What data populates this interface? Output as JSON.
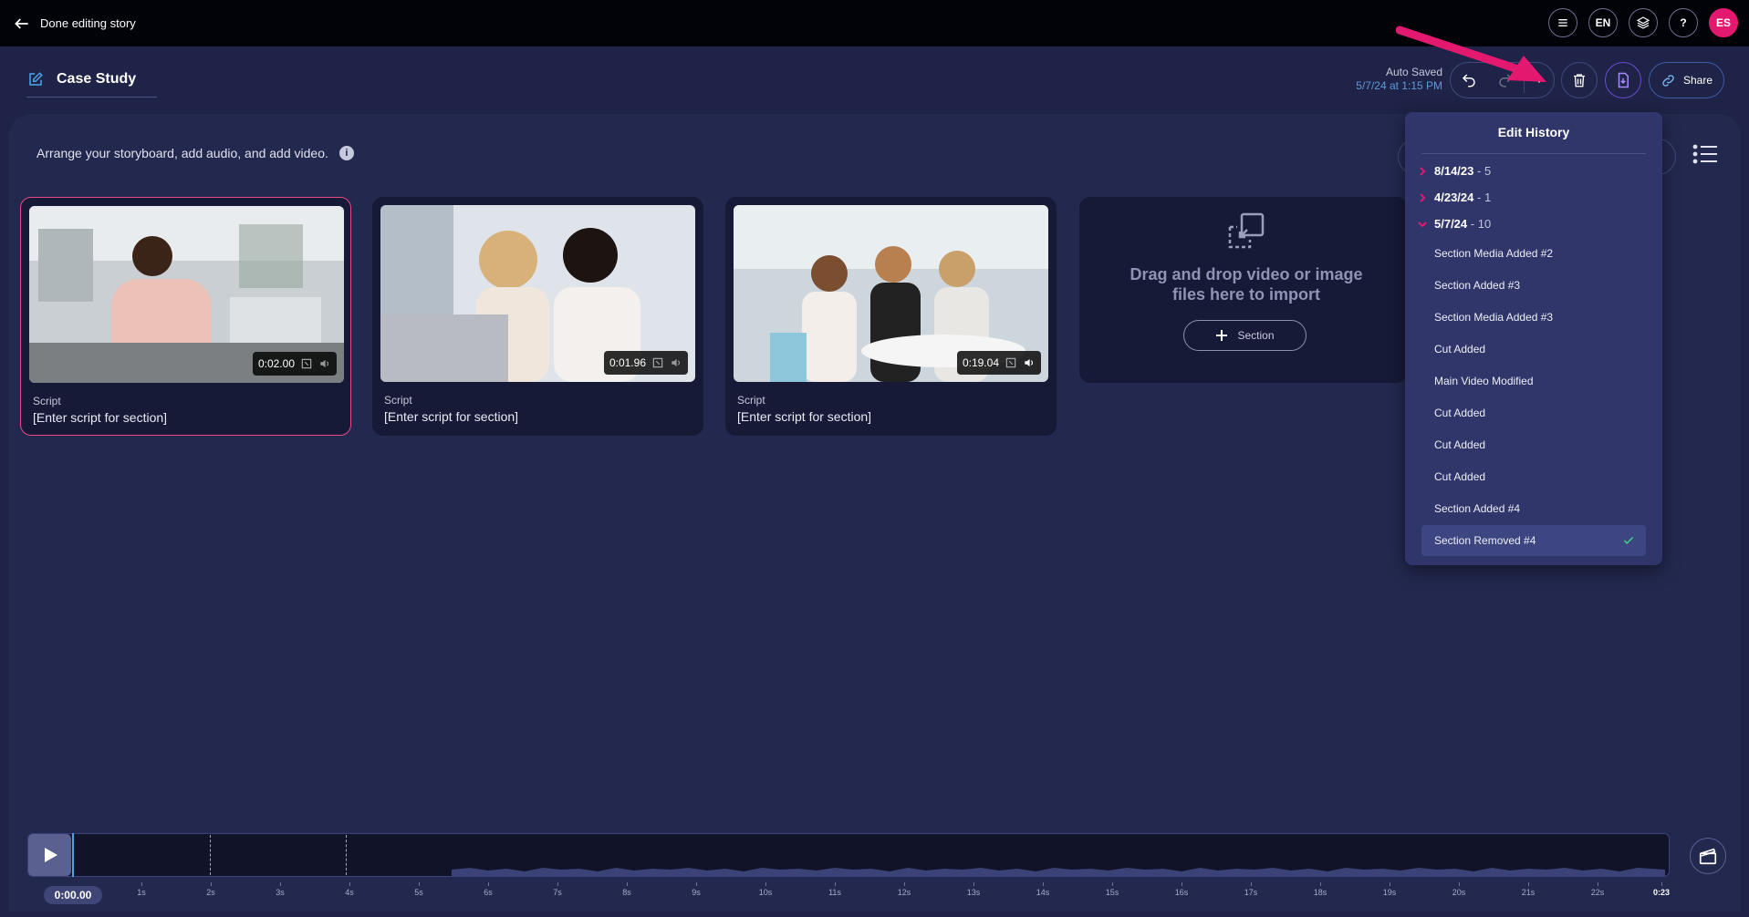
{
  "topbar": {
    "back_label": "Done editing story",
    "language": "EN",
    "help": "?",
    "avatar_initials": "ES"
  },
  "story": {
    "title": "Case Study",
    "autosave_label": "Auto Saved",
    "autosave_time": "5/7/24 at 1:15 PM",
    "share_label": "Share"
  },
  "instructions": "Arrange your storyboard, add audio, and add video.",
  "info_glyph": "i",
  "cards": [
    {
      "duration": "0:02.00",
      "script_label": "Script",
      "script_placeholder": "[Enter script for section]",
      "selected": true
    },
    {
      "duration": "0:01.96",
      "script_label": "Script",
      "script_placeholder": "[Enter script for section]",
      "selected": false
    },
    {
      "duration": "0:19.04",
      "script_label": "Script",
      "script_placeholder": "[Enter script for section]",
      "selected": false
    }
  ],
  "dropzone": {
    "text_line1": "Drag and drop video or image",
    "text_line2": "files here to import",
    "section_label": "Section"
  },
  "history": {
    "title": "Edit History",
    "groups": [
      {
        "date": "8/14/23",
        "count": "- 5",
        "expanded": false
      },
      {
        "date": "4/23/24",
        "count": "- 1",
        "expanded": false
      },
      {
        "date": "5/7/24",
        "count": "- 10",
        "expanded": true
      }
    ],
    "items": [
      "Section Media Added #2",
      "Section Added #3",
      "Section Media Added #3",
      "Cut Added",
      "Main Video Modified",
      "Cut Added",
      "Cut Added",
      "Cut Added",
      "Section Added #4",
      "Section Removed #4"
    ],
    "active_index": 9
  },
  "timeline": {
    "current_time": "0:00.00",
    "ticks": [
      "1s",
      "2s",
      "3s",
      "4s",
      "5s",
      "6s",
      "7s",
      "8s",
      "9s",
      "10s",
      "11s",
      "12s",
      "13s",
      "14s",
      "15s",
      "16s",
      "17s",
      "18s",
      "19s",
      "20s",
      "21s",
      "22s"
    ],
    "end_label": "0:23"
  },
  "colors": {
    "accent_pink": "#e3196f",
    "check_green": "#3ed28a",
    "autosave_blue": "#5d9ad8"
  }
}
